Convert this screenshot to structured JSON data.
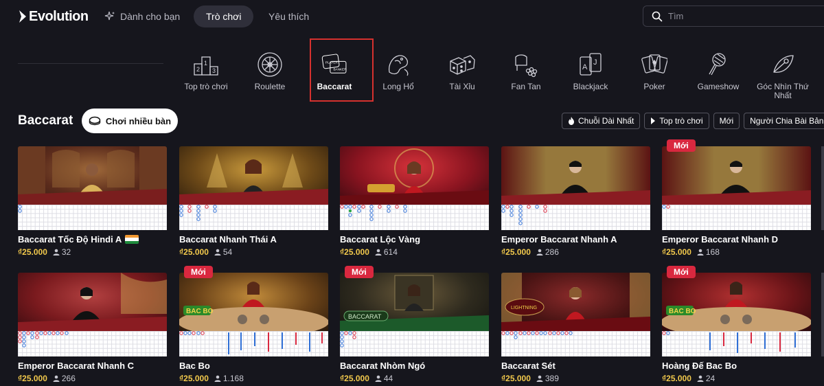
{
  "header": {
    "logo": "Evolution",
    "nav": [
      {
        "label": "Dành cho bạn"
      },
      {
        "label": "Trò chơi"
      },
      {
        "label": "Yêu thích"
      }
    ],
    "search": {
      "placeholder": "Tìm"
    }
  },
  "categories": [
    {
      "label": "Top trò chơi",
      "icon": "podium-icon"
    },
    {
      "label": "Roulette",
      "icon": "roulette-wheel-icon"
    },
    {
      "label": "Baccarat",
      "icon": "baccarat-cards-icon"
    },
    {
      "label": "Long Hổ",
      "icon": "dragon-tiger-icon"
    },
    {
      "label": "Tài Xỉu",
      "icon": "dice-icon"
    },
    {
      "label": "Fan Tan",
      "icon": "fan-tan-icon"
    },
    {
      "label": "Blackjack",
      "icon": "blackjack-cards-icon"
    },
    {
      "label": "Poker",
      "icon": "poker-cards-icon"
    },
    {
      "label": "Gameshow",
      "icon": "microphone-icon"
    },
    {
      "label": "Góc Nhìn Thứ Nhất",
      "icon": "first-person-icon"
    }
  ],
  "section": {
    "title": "Baccarat",
    "multi_table": "Chơi nhiều bàn",
    "filters": [
      "Chuỗi Dài Nhất",
      "Top trò chơi",
      "Mới",
      "Người Chia Bài Bản"
    ]
  },
  "badge_new": "Mới",
  "colors": {
    "accent_gold": "#f2c94c",
    "badge_red": "#d9283f",
    "highlight_red": "#d6312e"
  },
  "games": [
    {
      "title": "Baccarat Tốc Độ Hindi A",
      "price": "₫25.000",
      "players": "32",
      "flag": "india",
      "isNew": false
    },
    {
      "title": "Baccarat Nhanh Thái A",
      "price": "₫25.000",
      "players": "54",
      "isNew": false
    },
    {
      "title": "Baccarat Lộc Vàng",
      "price": "₫25.000",
      "players": "614",
      "isNew": false
    },
    {
      "title": "Emperor Baccarat Nhanh A",
      "price": "₫25.000",
      "players": "286",
      "isNew": false
    },
    {
      "title": "Emperor Baccarat Nhanh D",
      "price": "₫25.000",
      "players": "168",
      "isNew": true
    },
    {
      "title": "Emperor Baccarat Nhanh C",
      "price": "₫25.000",
      "players": "266",
      "isNew": false
    },
    {
      "title": "Bac Bo",
      "price": "₫25.000",
      "players": "1.168",
      "isNew": true
    },
    {
      "title": "Baccarat Nhòm Ngó",
      "price": "₫25.000",
      "players": "44",
      "isNew": true
    },
    {
      "title": "Baccarat Sét",
      "price": "₫25.000",
      "players": "389",
      "isNew": false
    },
    {
      "title": "Hoàng Đế Bac Bo",
      "price": "₫25.000",
      "players": "24",
      "isNew": true
    }
  ]
}
